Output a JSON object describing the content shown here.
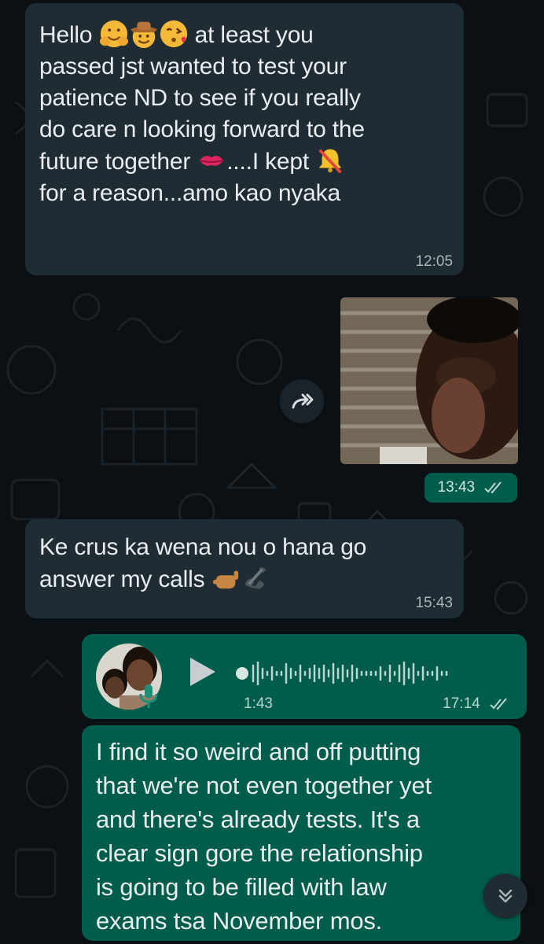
{
  "messages": [
    {
      "direction": "incoming",
      "parts": [
        "Hello ",
        " at least you\npassed jst wanted to test your\npatience ND to see if you really\ndo care n looking forward to the\nfuture together ",
        "....I kept ",
        "\nfor a reason...amo kao nyaka"
      ],
      "emojis": [
        "hugging-face",
        "cowboy-hat-face",
        "face-blowing-kiss",
        "kiss-mark",
        "bell-with-slash"
      ],
      "time": "12:05"
    },
    {
      "direction": "outgoing",
      "type": "image",
      "time": "13:43",
      "status": "read"
    },
    {
      "direction": "incoming",
      "parts": [
        "Ke crus ka wena nou o hana go\nanswer my calls "
      ],
      "emojis": [
        "call-me-hand",
        "telephone-receiver"
      ],
      "time": "15:43"
    },
    {
      "direction": "outgoing",
      "type": "voice",
      "duration": "1:43",
      "time": "17:14",
      "status": "read"
    },
    {
      "direction": "outgoing",
      "text": "I find it so weird and off putting\nthat we're not even together yet\nand there's already tests. It's a\nclear sign gore the relationship\nis going to be filled with law\nexams tsa November mos."
    }
  ],
  "icons": {
    "forward": "forward-icon",
    "scroll": "double-chevron-down-icon",
    "ticks": "double-check-icon",
    "mic": "mic-icon"
  },
  "colors": {
    "background": "#0b1014",
    "incoming_bubble": "#1f2c34",
    "outgoing_bubble": "#005c4b",
    "read_ticks": "#b8d6cf"
  }
}
